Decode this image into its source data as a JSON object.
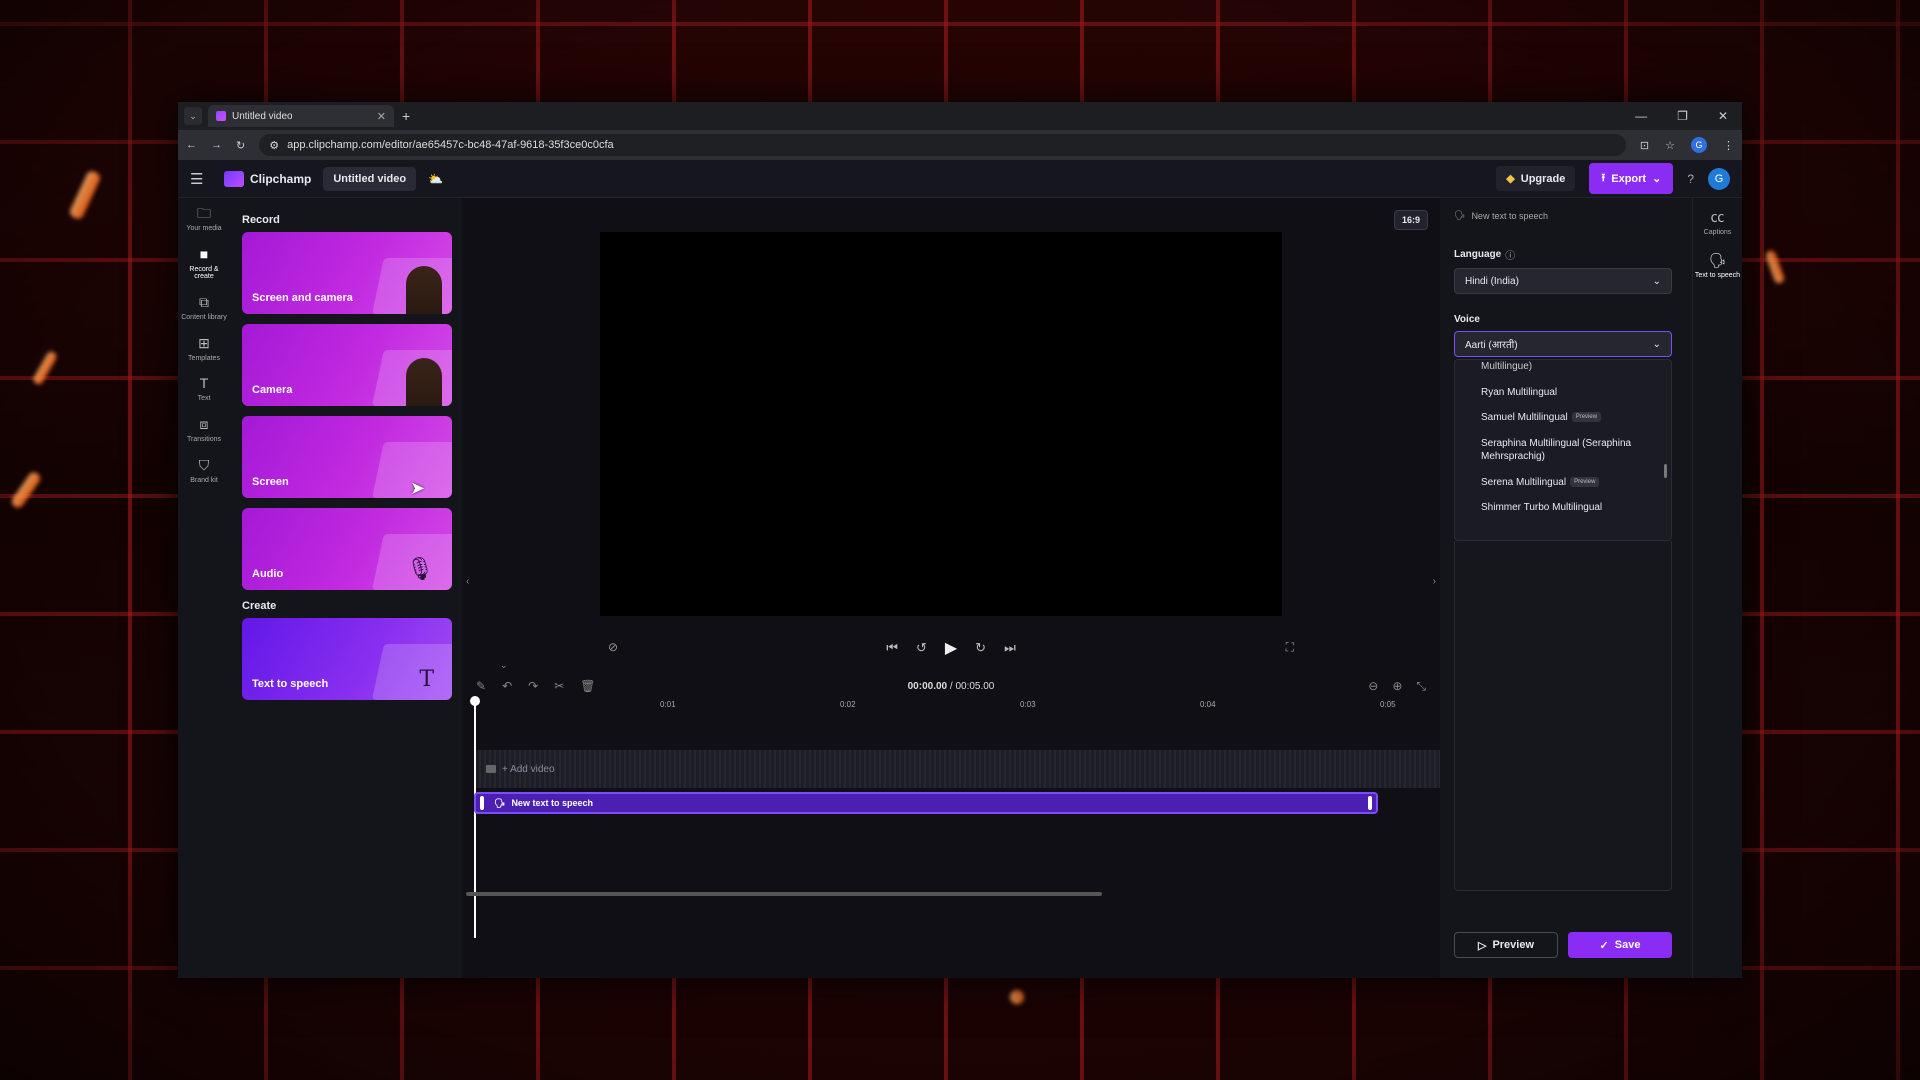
{
  "browser": {
    "tab_title": "Untitled video",
    "url": "app.clipchamp.com/editor/ae65457c-bc48-47af-9618-35f3ce0c0cfa",
    "profile_initial": "G"
  },
  "header": {
    "brand": "Clipchamp",
    "project_title": "Untitled video",
    "upgrade_label": "Upgrade",
    "export_label": "Export",
    "avatar_initial": "G"
  },
  "left_rail": {
    "items": [
      {
        "label": "Your media",
        "icon": "folder-icon"
      },
      {
        "label": "Record & create",
        "icon": "camera-icon"
      },
      {
        "label": "Content library",
        "icon": "library-icon"
      },
      {
        "label": "Templates",
        "icon": "templates-icon"
      },
      {
        "label": "Text",
        "icon": "text-icon"
      },
      {
        "label": "Transitions",
        "icon": "transitions-icon"
      },
      {
        "label": "Brand kit",
        "icon": "brand-kit-icon"
      }
    ]
  },
  "panel": {
    "record_heading": "Record",
    "create_heading": "Create",
    "cards": {
      "screen_camera": "Screen and camera",
      "camera": "Camera",
      "screen": "Screen",
      "audio": "Audio",
      "tts": "Text to speech"
    }
  },
  "preview": {
    "aspect_ratio": "16:9"
  },
  "timeline": {
    "current_time": "00:00.00",
    "total_time": "00:05.00",
    "ruler": [
      "0:01",
      "0:02",
      "0:03",
      "0:04",
      "0:05"
    ],
    "add_video_label": "+ Add video",
    "clip_label": "New text to speech"
  },
  "tts_panel": {
    "header": "New text to speech",
    "language_label": "Language",
    "language_value": "Hindi (India)",
    "voice_label": "Voice",
    "voice_value": "Aarti (आरती)",
    "voice_options": [
      {
        "name": "Multilingue)",
        "badge": ""
      },
      {
        "name": "Ryan Multilingual",
        "badge": ""
      },
      {
        "name": "Samuel Multilingual",
        "badge": "Preview"
      },
      {
        "name": "Seraphina Multilingual (Seraphina Mehrsprachig)",
        "badge": ""
      },
      {
        "name": "Serena Multilingual",
        "badge": "Preview"
      },
      {
        "name": "Shimmer Turbo Multilingual",
        "badge": ""
      }
    ],
    "preview_label": "Preview",
    "save_label": "Save"
  },
  "right_rail": {
    "captions_label": "Captions",
    "tts_label": "Text to speech"
  }
}
